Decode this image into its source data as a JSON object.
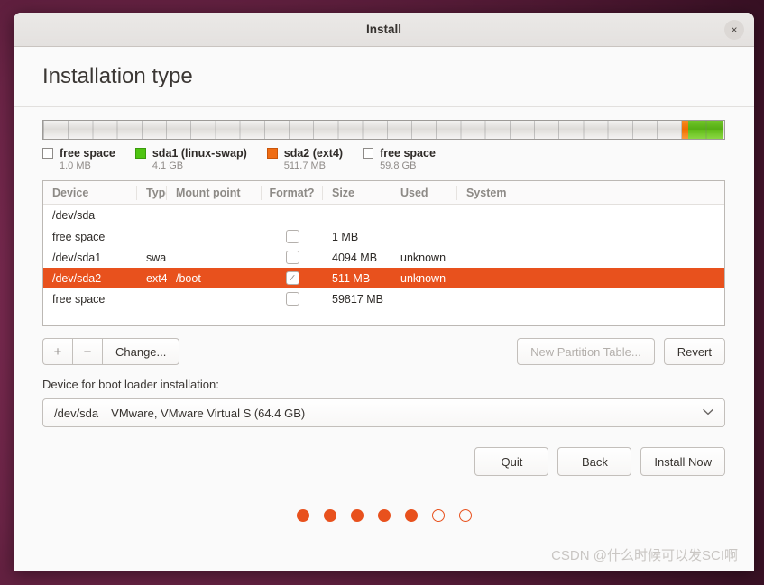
{
  "window": {
    "title": "Install",
    "close_icon": "close-icon",
    "close_glyph": "×"
  },
  "page": {
    "heading": "Installation type"
  },
  "partition_bar": {
    "segments": [
      {
        "name": "free space",
        "color": "#e8e6e4",
        "kind": "grey",
        "percent": 0.2
      },
      {
        "name": "sda1 (linux-swap)",
        "color": "#4ec411",
        "kind": "green",
        "percent": 5.1
      },
      {
        "name": "sda2 (ext4)",
        "color": "#ef6c13",
        "kind": "orange",
        "percent": 0.9
      },
      {
        "name": "free space",
        "color": "#e8e6e4",
        "kind": "grey",
        "percent": 93.8
      }
    ]
  },
  "legend": [
    {
      "label": "free space",
      "size": "1.0 MB",
      "swatch": "empty",
      "icon": "checkbox-empty-icon"
    },
    {
      "label": "sda1 (linux-swap)",
      "size": "4.1 GB",
      "swatch": "green",
      "icon": "color-swatch-green-icon"
    },
    {
      "label": "sda2 (ext4)",
      "size": "511.7 MB",
      "swatch": "orange",
      "icon": "color-swatch-orange-icon"
    },
    {
      "label": "free space",
      "size": "59.8 GB",
      "swatch": "empty",
      "icon": "checkbox-empty-icon"
    }
  ],
  "table": {
    "columns": [
      "Device",
      "Type",
      "Mount point",
      "Format?",
      "Size",
      "Used",
      "System"
    ],
    "device_row": "/dev/sda",
    "rows": [
      {
        "device": "free space",
        "type": "",
        "mount": "",
        "format": false,
        "size": "1 MB",
        "used": "",
        "system": "",
        "selected": false
      },
      {
        "device": "/dev/sda1",
        "type": "swap",
        "mount": "",
        "format": false,
        "size": "4094 MB",
        "used": "unknown",
        "system": "",
        "selected": false
      },
      {
        "device": "/dev/sda2",
        "type": "ext4",
        "mount": "/boot",
        "format": true,
        "size": "511 MB",
        "used": "unknown",
        "system": "",
        "selected": true
      },
      {
        "device": "free space",
        "type": "",
        "mount": "",
        "format": false,
        "size": "59817 MB",
        "used": "",
        "system": "",
        "selected": false
      }
    ],
    "check_glyph": "✓",
    "selected_color": "#e8511d"
  },
  "toolbar": {
    "add_label": "+",
    "remove_label": "−",
    "change_label": "Change...",
    "new_partition_table_label": "New Partition Table...",
    "new_partition_table_disabled": true,
    "revert_label": "Revert"
  },
  "bootloader": {
    "label": "Device for boot loader installation:",
    "selected_device": "/dev/sda",
    "selected_description": "VMware, VMware Virtual S (64.4 GB)",
    "arrow_glyph": "⌄",
    "arrow_icon": "chevron-down-icon"
  },
  "actions": {
    "quit_label": "Quit",
    "back_label": "Back",
    "install_label": "Install Now"
  },
  "progress_dots": {
    "total": 7,
    "filled": 5,
    "color": "#e8511d"
  },
  "watermark": {
    "text": "CSDN @什么时候可以发SCI啊"
  }
}
